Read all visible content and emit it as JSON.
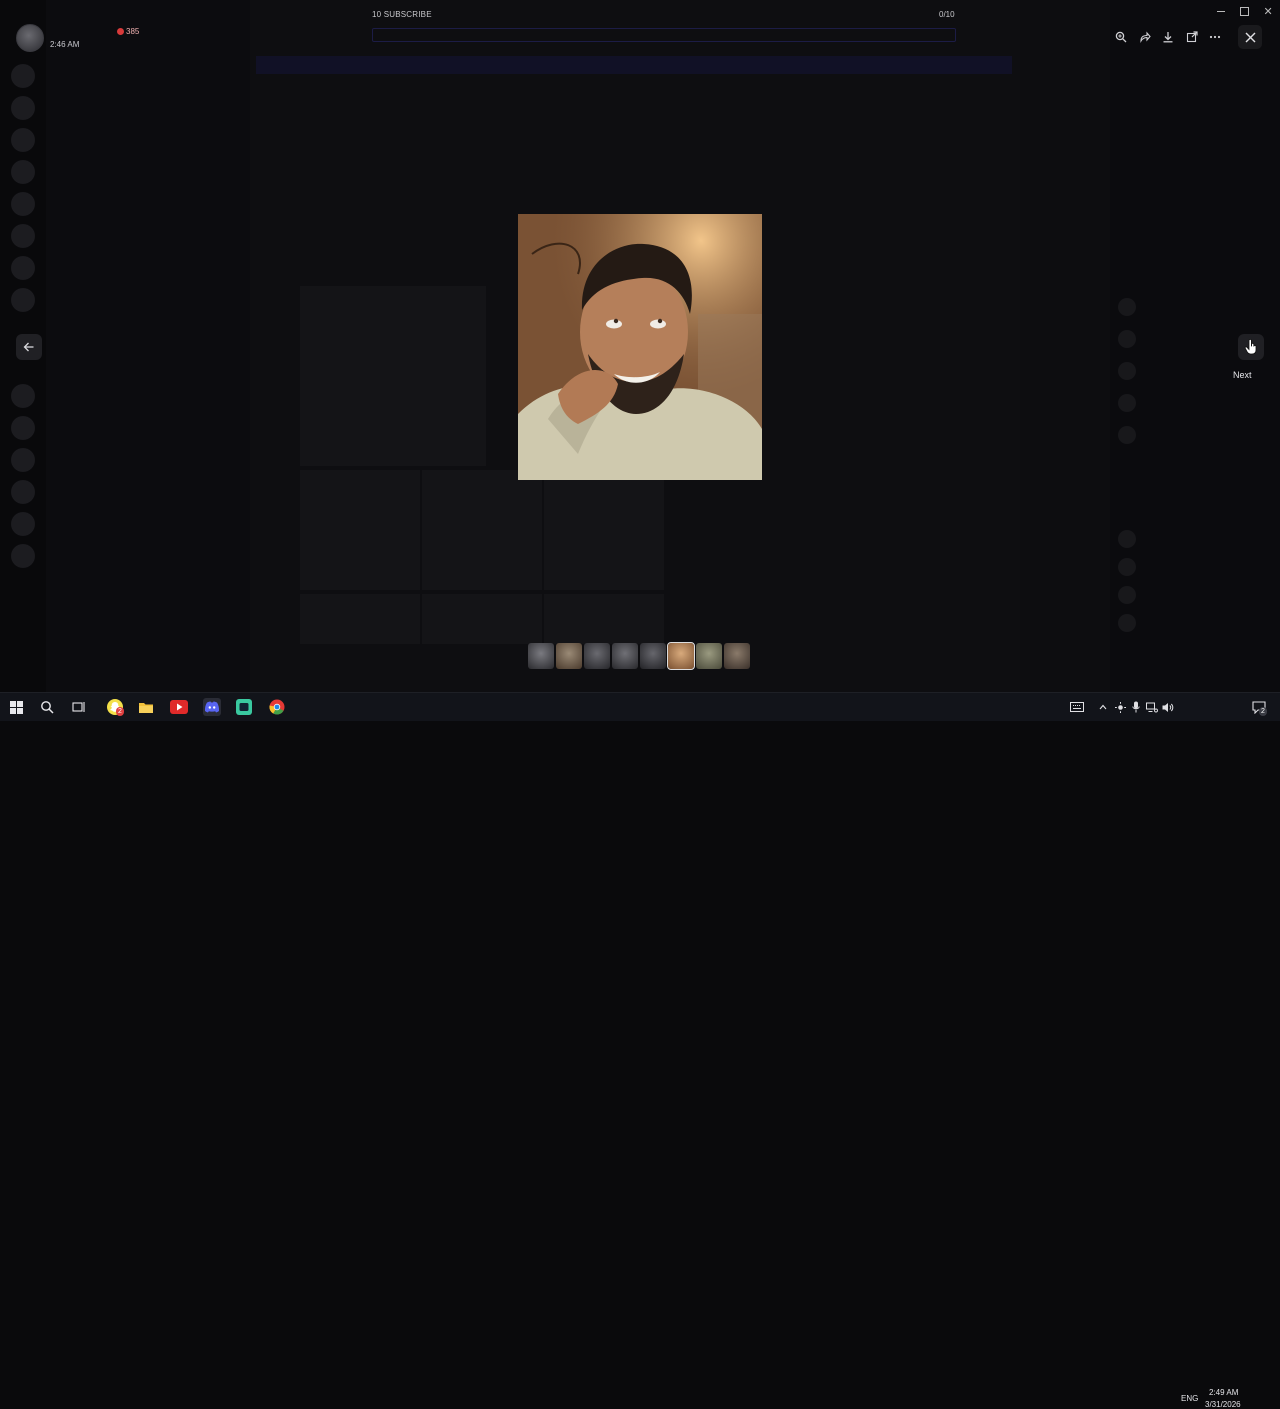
{
  "overlay": {
    "time": "2:46 AM",
    "live_count": "385",
    "subscribe_text": "10 SUBSCRIBE",
    "timer": "0/10",
    "tooltip_next": "Next"
  },
  "toolbar": {
    "zoom_icon": "zoom-in-icon",
    "forward_icon": "forward-icon",
    "download_icon": "download-icon",
    "open_icon": "open-external-icon",
    "more_icon": "more-icon",
    "close_icon": "close-icon"
  },
  "thumbnails": [
    {
      "name": "thumb-1",
      "tone": "#4a4a4f"
    },
    {
      "name": "thumb-2",
      "tone": "#6a5a4a"
    },
    {
      "name": "thumb-3",
      "tone": "#3f3f45"
    },
    {
      "name": "thumb-4",
      "tone": "#45454b"
    },
    {
      "name": "thumb-5",
      "tone": "#3d3d43"
    },
    {
      "name": "thumb-6",
      "tone": "#b58a5e"
    },
    {
      "name": "thumb-7",
      "tone": "#6b6b58"
    },
    {
      "name": "thumb-8",
      "tone": "#5a5048"
    }
  ],
  "taskbar": {
    "badge_count": "2",
    "language": "ENG",
    "time": "2:49 AM",
    "date": "3/31/2026",
    "notification_count": "2"
  },
  "colors": {
    "accent": "#5865f2",
    "overlay_bg": "#0a0a0c",
    "live_red": "#d83a3a"
  }
}
